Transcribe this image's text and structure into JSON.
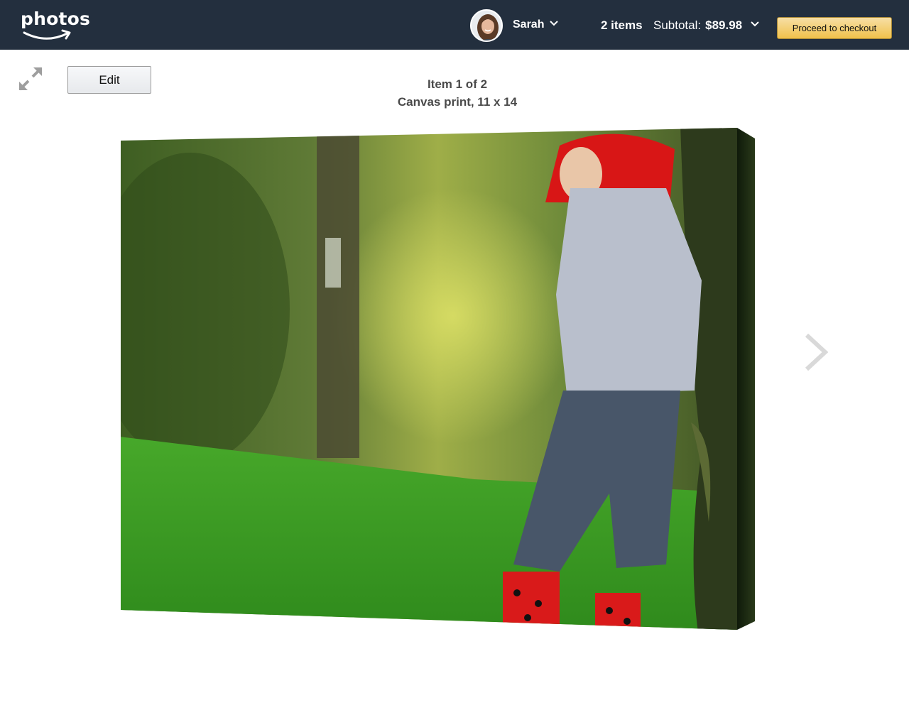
{
  "header": {
    "logo_text": "photos",
    "user_name": "Sarah",
    "items_count": "2 items",
    "subtotal_label": "Subtotal:",
    "subtotal_amount": "$89.98",
    "checkout_label": "Proceed to checkout"
  },
  "toolbar": {
    "edit_label": "Edit"
  },
  "item": {
    "position": "Item 1 of 2",
    "description": "Canvas print, 11 x 14"
  },
  "icons": {
    "fullscreen": "expand-arrows-icon",
    "next": "chevron-right-icon",
    "user_menu": "chevron-down-icon",
    "subtotal_menu": "chevron-down-icon",
    "logo_smile": "smile-arrow-icon"
  },
  "colors": {
    "topbar": "#232f3e",
    "checkout_button": "#f0c14b",
    "text": "#4a4a4a",
    "icon_gray": "#9e9e9e",
    "next_arrow": "#d9d9d9"
  }
}
